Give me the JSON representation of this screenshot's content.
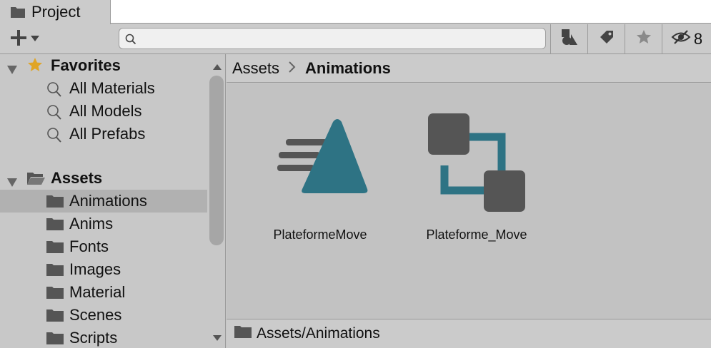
{
  "window": {
    "tab_title": "Project"
  },
  "toolbar": {
    "search": {
      "value": "",
      "placeholder": ""
    },
    "hidden_count": "8"
  },
  "sidebar": {
    "favorites": {
      "label": "Favorites",
      "items": [
        {
          "label": "All Materials"
        },
        {
          "label": "All Models"
        },
        {
          "label": "All Prefabs"
        }
      ]
    },
    "assets": {
      "label": "Assets",
      "items": [
        {
          "label": "Animations",
          "selected": true
        },
        {
          "label": "Anims"
        },
        {
          "label": "Fonts"
        },
        {
          "label": "Images"
        },
        {
          "label": "Material"
        },
        {
          "label": "Scenes"
        },
        {
          "label": "Scripts"
        }
      ]
    }
  },
  "breadcrumb": {
    "root": "Assets",
    "current": "Animations"
  },
  "assets_grid": [
    {
      "name": "PlateformeMove",
      "icon": "animation-clip-icon"
    },
    {
      "name": "Plateforme_Move",
      "icon": "animator-controller-icon"
    }
  ],
  "status": {
    "path": "Assets/Animations"
  },
  "colors": {
    "accent_teal": "#2e7384",
    "icon_gray": "#555555",
    "selected_row": "#b1b1b1"
  }
}
